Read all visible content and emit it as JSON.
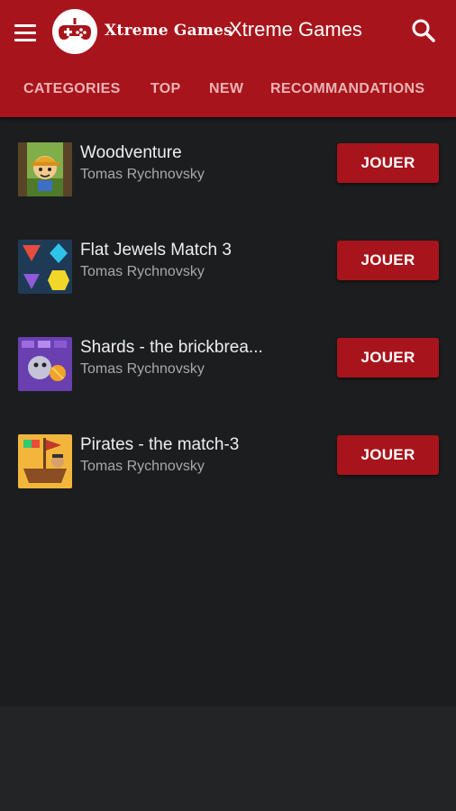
{
  "header": {
    "logo_text": "Xtreme Games",
    "title": "Xtreme Games",
    "background_color": "#a8141b"
  },
  "tabs": [
    {
      "label": "CATEGORIES"
    },
    {
      "label": "TOP"
    },
    {
      "label": "NEW"
    },
    {
      "label": "RECOMMANDATIONS"
    }
  ],
  "games": [
    {
      "title": "Woodventure",
      "author": "Tomas Rychnovsky",
      "button": "JOUER",
      "icon": "woodventure-thumbnail"
    },
    {
      "title": "Flat Jewels Match 3",
      "author": "Tomas Rychnovsky",
      "button": "JOUER",
      "icon": "flat-jewels-thumbnail"
    },
    {
      "title": "Shards - the brickbrea...",
      "author": "Tomas Rychnovsky",
      "button": "JOUER",
      "icon": "shards-thumbnail"
    },
    {
      "title": "Pirates - the match-3",
      "author": "Tomas Rychnovsky",
      "button": "JOUER",
      "icon": "pirates-thumbnail"
    }
  ],
  "colors": {
    "accent": "#a8141b",
    "background": "#1c1d1f",
    "tab_text": "#e9b3b5"
  }
}
